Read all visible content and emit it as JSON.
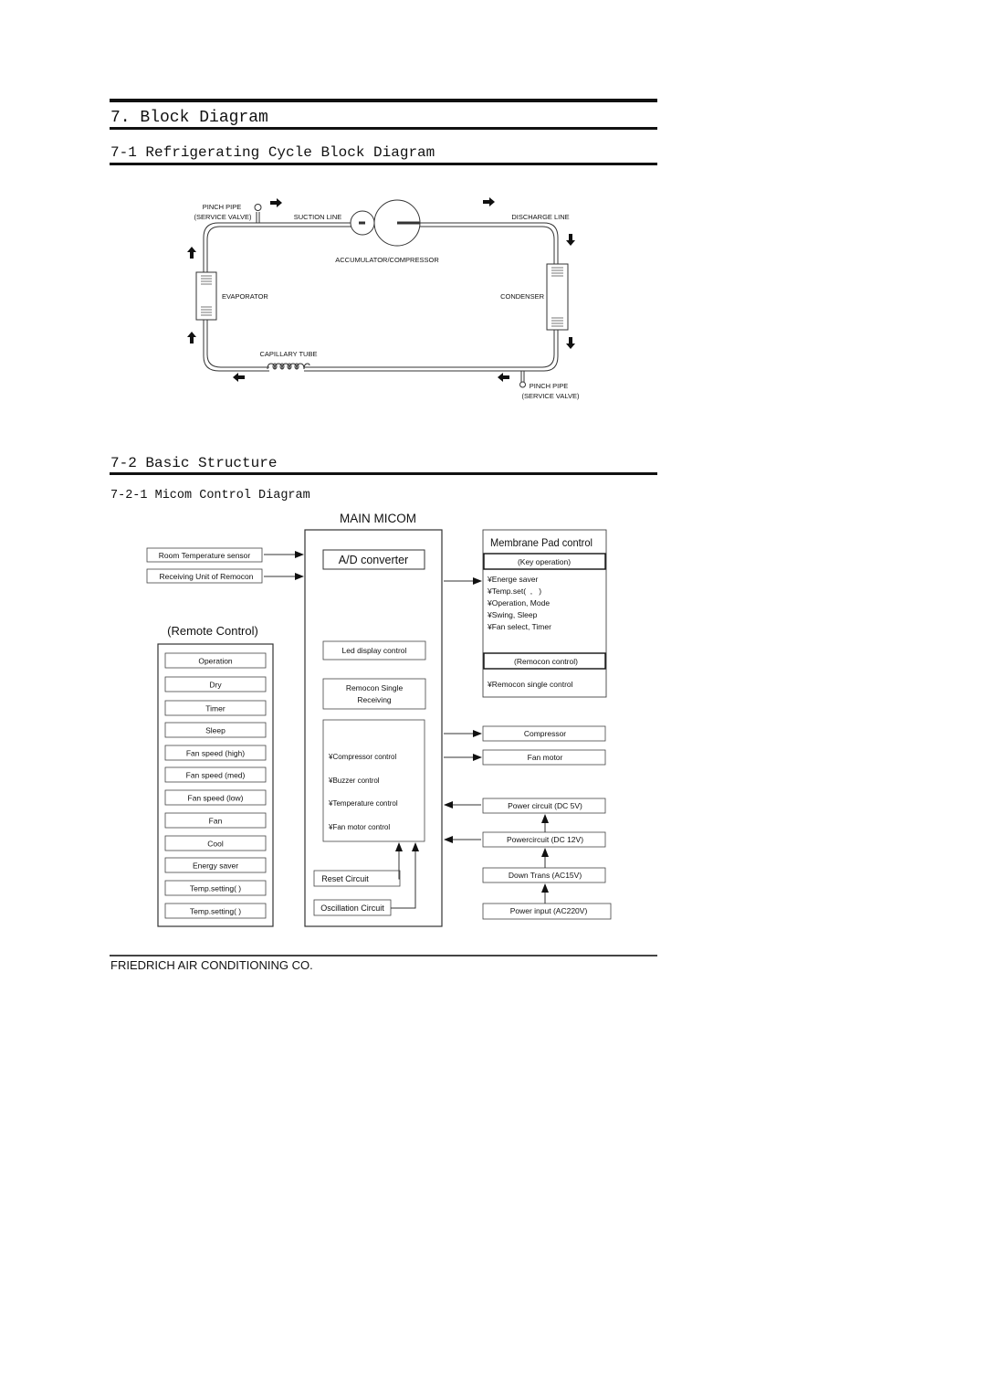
{
  "headings": {
    "section": "7. Block Diagram",
    "subsection_1": "7-1 Refrigerating Cycle Block Diagram",
    "subsection_2": "7-2 Basic Structure",
    "subsubsection": "7-2-1 Micom Control Diagram"
  },
  "refrigerating_cycle": {
    "pinch_pipe_top": [
      "PINCH PIPE",
      "(SERVICE VALVE)"
    ],
    "suction_line": "SUCTION LINE",
    "discharge_line": "DISCHARGE LINE",
    "accumulator_compressor": "ACCUMULATOR/COMPRESSOR",
    "evaporator": "EVAPORATOR",
    "condenser": "CONDENSER",
    "capillary_tube": "CAPILLARY TUBE",
    "pinch_pipe_bottom": [
      "PINCH PIPE",
      "(SERVICE VALVE)"
    ]
  },
  "micom": {
    "main_title": "MAIN MICOM",
    "ad_converter": "A/D converter",
    "inputs": [
      "Room Temperature sensor",
      "Receiving Unit of Remocon"
    ],
    "led_display": "Led display control",
    "remocon_single": [
      "Remocon Single",
      "Receiving"
    ],
    "controls": [
      "¥Compressor control",
      "¥Buzzer control",
      "¥Temperature control",
      "¥Fan motor control"
    ],
    "reset_circuit": "Reset Circuit",
    "oscillation_circuit": "Oscillation Circuit",
    "remote_control": {
      "title": "(Remote Control)",
      "buttons": [
        "Operation",
        "Dry",
        "Timer",
        "Sleep",
        "Fan speed (high)",
        "Fan speed (med)",
        "Fan speed (low)",
        "Fan",
        "Cool",
        "Energy saver",
        "Temp.setting(  )",
        "Temp.setting(  )"
      ]
    },
    "membrane_pad": {
      "title": "Membrane Pad control",
      "key_operation": "(Key operation)",
      "key_items": [
        "¥Energe saver",
        "¥Temp.set(  ,   )",
        "¥Operation, Mode",
        "¥Swing, Sleep",
        "¥Fan select, Timer"
      ],
      "remocon_control": "(Remocon control)",
      "remocon_items": [
        "¥Remocon single control"
      ]
    },
    "outputs": [
      "Compressor",
      "Fan motor"
    ],
    "power_chain": [
      "Power circuit (DC 5V)",
      "Powercircuit (DC 12V)",
      "Down Trans (AC15V)",
      "Power input (AC220V)"
    ]
  },
  "footer": "FRIEDRICH AIR CONDITIONING CO."
}
